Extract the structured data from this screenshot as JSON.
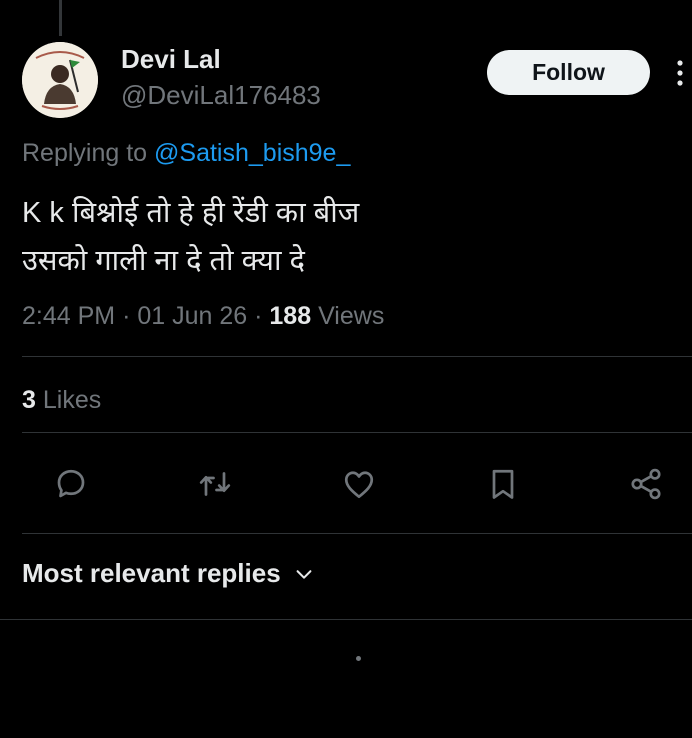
{
  "author": {
    "name": "Devi Lal",
    "handle": "@DeviLal176483"
  },
  "follow_label": "Follow",
  "reply_context": {
    "prefix": "Replying to",
    "handle": "@Satish_bish9e_"
  },
  "tweet": {
    "lines": [
      "K k बिश्नोई तो हे ही रेंडी का बीज",
      "उसको गाली ना दे तो क्या दे"
    ]
  },
  "meta": {
    "time": "2:44 PM",
    "date": "01 Jun 26",
    "separator": "·",
    "views_count": "188",
    "views_label": "Views"
  },
  "engagement": {
    "likes_count": "3",
    "likes_label": "Likes"
  },
  "actions": [
    {
      "name": "reply",
      "icon": "reply-bubble-icon"
    },
    {
      "name": "retweet",
      "icon": "retweet-icon"
    },
    {
      "name": "like",
      "icon": "heart-icon"
    },
    {
      "name": "bookmark",
      "icon": "bookmark-icon"
    },
    {
      "name": "share",
      "icon": "share-icon"
    }
  ],
  "replies_sort": {
    "label": "Most relevant replies",
    "icon": "chevron-down-icon"
  },
  "colors": {
    "background": "#000000",
    "text_primary": "#e7e9ea",
    "text_secondary": "#71767b",
    "link": "#1d9bf0",
    "divider": "#2f3336",
    "follow_bg": "#eff3f4"
  }
}
